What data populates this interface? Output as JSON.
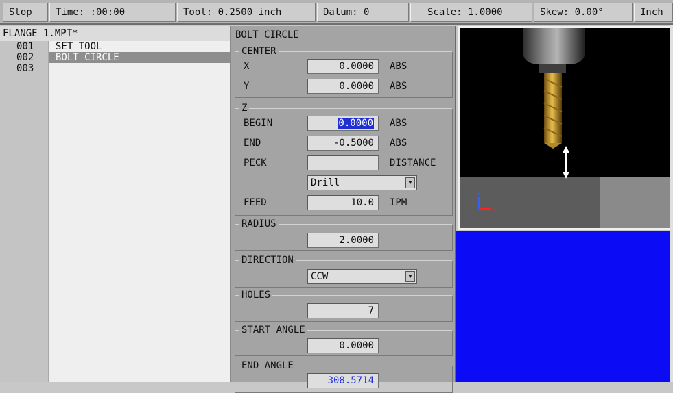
{
  "status_bar": {
    "stop": "Stop",
    "time": "Time: :00:00",
    "tool": "Tool: 0.2500  inch",
    "datum": "Datum: 0",
    "scale": "Scale: 1.0000",
    "skew": "Skew: 0.00°",
    "units": "Inch"
  },
  "program": {
    "title": "FLANGE 1.MPT*",
    "lines": [
      {
        "number": "001",
        "text": "SET TOOL",
        "selected": false
      },
      {
        "number": "002",
        "text": "BOLT CIRCLE",
        "selected": true
      },
      {
        "number": "003",
        "text": "",
        "selected": false
      }
    ]
  },
  "params": {
    "title": "BOLT CIRCLE",
    "center": {
      "legend": "CENTER",
      "x_label": "X",
      "x_value": "0.0000",
      "x_unit": "ABS",
      "y_label": "Y",
      "y_value": "0.0000",
      "y_unit": "ABS"
    },
    "z": {
      "legend": "Z",
      "begin_label": "BEGIN",
      "begin_value": "0.0000",
      "begin_unit": "ABS",
      "end_label": "END",
      "end_value": "-0.5000",
      "end_unit": "ABS",
      "peck_label": "PECK",
      "peck_value": "",
      "peck_unit": "DISTANCE",
      "mode_value": "Drill",
      "feed_label": "FEED",
      "feed_value": "10.0",
      "feed_unit": "IPM"
    },
    "radius": {
      "legend": "RADIUS",
      "value": "2.0000"
    },
    "direction": {
      "legend": "DIRECTION",
      "value": "CCW"
    },
    "holes": {
      "legend": "HOLES",
      "value": "7"
    },
    "start_angle": {
      "legend": "START ANGLE",
      "value": "0.0000"
    },
    "end_angle": {
      "legend": "END ANGLE",
      "value": "308.5714"
    }
  },
  "view": {
    "axis_z": "z",
    "axis_x": "x"
  },
  "colors": {
    "selection": "#1f2fd4",
    "viewport_bg": "#000000",
    "blue_panel": "#0b0bf5",
    "drill_bit": "#d8a832"
  }
}
